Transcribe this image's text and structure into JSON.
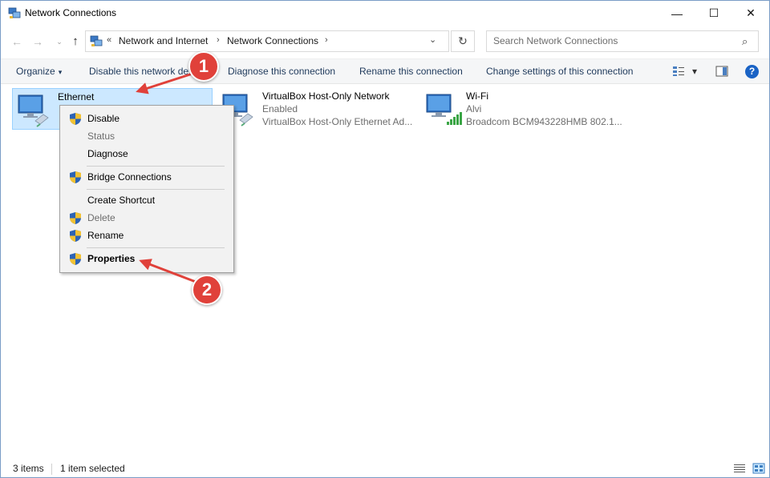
{
  "window": {
    "title": "Network Connections",
    "minimize_glyph": "—",
    "maximize_glyph": "☐",
    "close_glyph": "✕"
  },
  "nav": {
    "back_glyph": "←",
    "forward_glyph": "→",
    "recent_glyph": "⌄",
    "up_glyph": "↑",
    "overflow_glyph": "«",
    "breadcrumbs": [
      "Network and Internet",
      "Network Connections"
    ],
    "separator_glyph": "›",
    "dropdown_glyph": "⌄",
    "refresh_glyph": "↻",
    "search_placeholder": "Search Network Connections",
    "search_glyph": "⌕"
  },
  "commands": {
    "organize": "Organize",
    "disable_device": "Disable this network device",
    "diagnose": "Diagnose this connection",
    "rename": "Rename this connection",
    "change_settings": "Change settings of this connection",
    "dropdown_glyph": "▾",
    "help_glyph": "?"
  },
  "connections": [
    {
      "name": "Ethernet",
      "status": "",
      "device": "",
      "selected": true
    },
    {
      "name": "VirtualBox Host-Only Network",
      "status": "Enabled",
      "device": "VirtualBox Host-Only Ethernet Ad..."
    },
    {
      "name": "Wi-Fi",
      "status": "Alvi",
      "device": "Broadcom BCM943228HMB 802.1..."
    }
  ],
  "context_menu": {
    "items": [
      {
        "label": "Disable",
        "shield": true,
        "disabled": false
      },
      {
        "label": "Status",
        "shield": false,
        "disabled": true
      },
      {
        "label": "Diagnose",
        "shield": false,
        "disabled": false
      },
      {
        "label": "Bridge Connections",
        "shield": true,
        "disabled": false
      },
      {
        "label": "Create Shortcut",
        "shield": false,
        "disabled": false
      },
      {
        "label": "Delete",
        "shield": true,
        "disabled": true
      },
      {
        "label": "Rename",
        "shield": true,
        "disabled": false
      },
      {
        "label": "Properties",
        "shield": true,
        "disabled": false,
        "bold": true
      }
    ]
  },
  "status_bar": {
    "item_count": "3 items",
    "selection": "1 item selected"
  },
  "annotations": {
    "step1": "1",
    "step2": "2",
    "color": "#e0413a"
  },
  "colors": {
    "selection_bg": "#cce8ff",
    "command_text": "#1e395b",
    "help_blue": "#1a63c5"
  }
}
